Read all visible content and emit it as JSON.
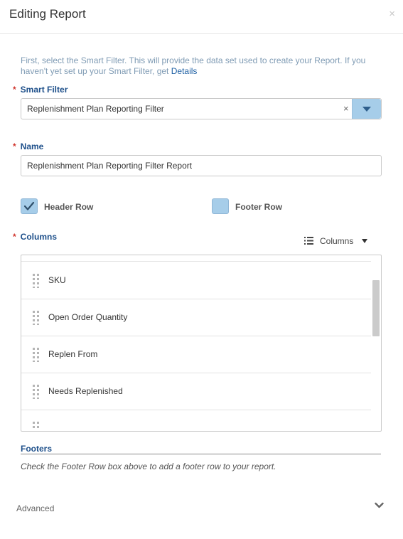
{
  "dialog": {
    "title": "Editing Report",
    "close_label": "×"
  },
  "intro": {
    "text": "First, select the Smart Filter. This will provide the data set used to create your Report. If you haven't yet set up your Smart Filter, get ",
    "link": "Details"
  },
  "smart_filter": {
    "required_marker": "*",
    "label": "Smart Filter",
    "value": "Replenishment Plan Reporting Filter",
    "clear_label": "×"
  },
  "name": {
    "required_marker": "*",
    "label": "Name",
    "value": "Replenishment Plan Reporting Filter Report"
  },
  "options": {
    "header_row": {
      "label": "Header Row",
      "checked": true
    },
    "footer_row": {
      "label": "Footer Row",
      "checked": false
    }
  },
  "columns": {
    "required_marker": "*",
    "label": "Columns",
    "toggle_label": "Columns",
    "items": [
      "SKU",
      "Open Order Quantity",
      "Replen From",
      "Needs Replenished",
      ""
    ]
  },
  "footers": {
    "title": "Footers",
    "note": "Check the Footer Row box above to add a footer row to your report."
  },
  "advanced": {
    "label": "Advanced"
  },
  "colors": {
    "accent": "#a6cde9",
    "label_blue": "#1d4f8a",
    "required_red": "#d0342c"
  },
  "icons": {
    "close": "close-icon",
    "dropdown": "triangle-down-icon",
    "check": "checkmark-icon",
    "list": "list-icon",
    "grip": "drag-handle-icon",
    "expand": "chevron-down-icon"
  }
}
